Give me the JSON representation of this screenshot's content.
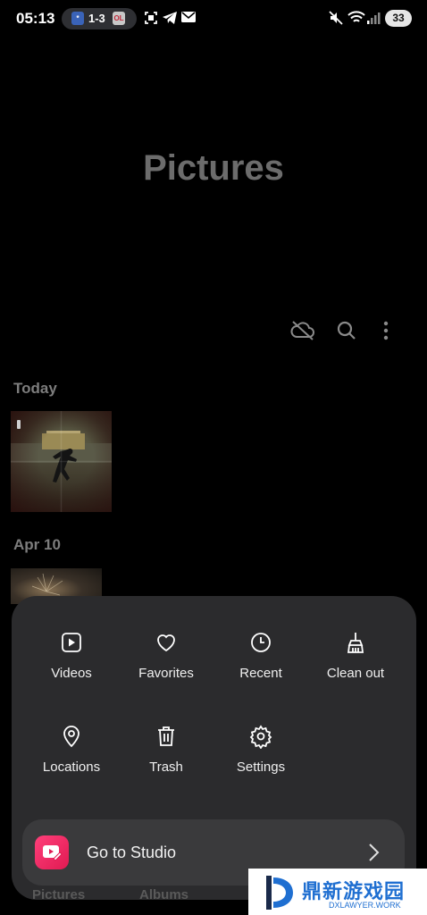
{
  "status_bar": {
    "time": "05:13",
    "score": "1-3",
    "team_a_abbr": "*",
    "team_b_abbr": "OL",
    "battery": "33",
    "icons": [
      "screenshot-icon",
      "telegram-icon",
      "mail-icon",
      "mute-icon",
      "wifi-icon",
      "signal-icon"
    ]
  },
  "header": {
    "title": "Pictures"
  },
  "toolbar": {
    "icons": [
      "cloud-off-icon",
      "search-icon",
      "more-vertical-icon"
    ]
  },
  "sections": [
    {
      "label": "Today"
    },
    {
      "label": "Apr 10"
    }
  ],
  "menu": {
    "items": [
      {
        "label": "Videos",
        "icon": "video-icon"
      },
      {
        "label": "Favorites",
        "icon": "heart-icon"
      },
      {
        "label": "Recent",
        "icon": "clock-icon"
      },
      {
        "label": "Clean out",
        "icon": "broom-icon"
      },
      {
        "label": "Locations",
        "icon": "location-pin-icon"
      },
      {
        "label": "Trash",
        "icon": "trash-icon"
      },
      {
        "label": "Settings",
        "icon": "gear-icon"
      }
    ],
    "studio": {
      "label": "Go to Studio",
      "icon": "studio-icon"
    }
  },
  "background_tabs": [
    "Pictures",
    "Albums"
  ],
  "watermark": {
    "name": "鼎新游戏园",
    "url": "DXLAWYER.WORK"
  },
  "colors": {
    "background": "#000000",
    "sheet": "#2b2b2d",
    "studio_button": "#3a3a3c",
    "studio_accent": "#ff3f7a",
    "title": "#6c6c6c",
    "watermark_blue": "#1f6fd1"
  }
}
